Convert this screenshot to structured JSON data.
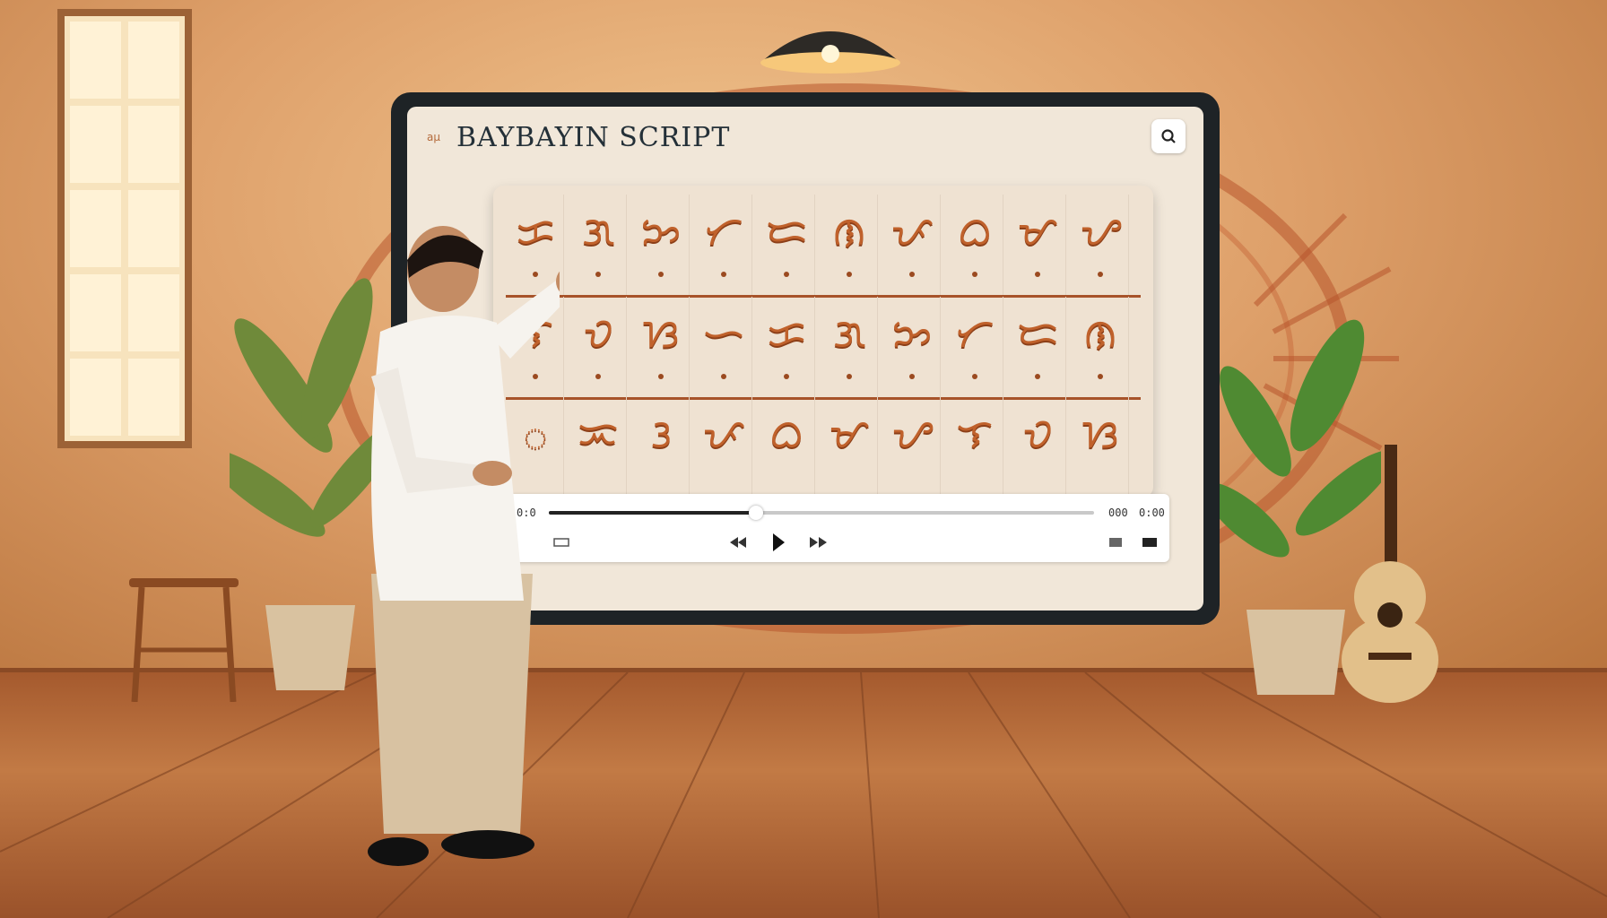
{
  "screen": {
    "logo_text": "aµ",
    "title": "BAYBAYIN SCRIPT"
  },
  "board": {
    "rows": [
      {
        "glyphs": [
          "ᜃ",
          "ᜄ",
          "ᜅ",
          "ᜆ",
          "ᜇ",
          "ᜈ",
          "ᜉ",
          "ᜊ",
          "ᜋ",
          "ᜌ"
        ]
      },
      {
        "glyphs": [
          "ᜎ",
          "ᜏ",
          "ᜐ",
          "ᜑ",
          "ᜃ",
          "ᜄ",
          "ᜅ",
          "ᜆ",
          "ᜇ",
          "ᜈ"
        ]
      },
      {
        "glyphs": [
          "ᜀ",
          "ᜁ",
          "ᜂ",
          "ᜉ",
          "ᜊ",
          "ᜋ",
          "ᜌ",
          "ᜎ",
          "ᜏ",
          "ᜐ"
        ]
      }
    ]
  },
  "player": {
    "time_elapsed": "0:0",
    "time_total": "000",
    "time_remaining": "0:00",
    "progress": 0.38
  },
  "colors": {
    "accent": "#c0612b",
    "tablet_frame": "#1e2326",
    "screen_bg": "#f1e7d9"
  },
  "icons": {
    "search": "search-icon",
    "play": "play-icon",
    "rewind": "rewind-icon",
    "forward": "forward-icon",
    "captions": "captions-icon",
    "fullscreen": "fullscreen-icon"
  }
}
